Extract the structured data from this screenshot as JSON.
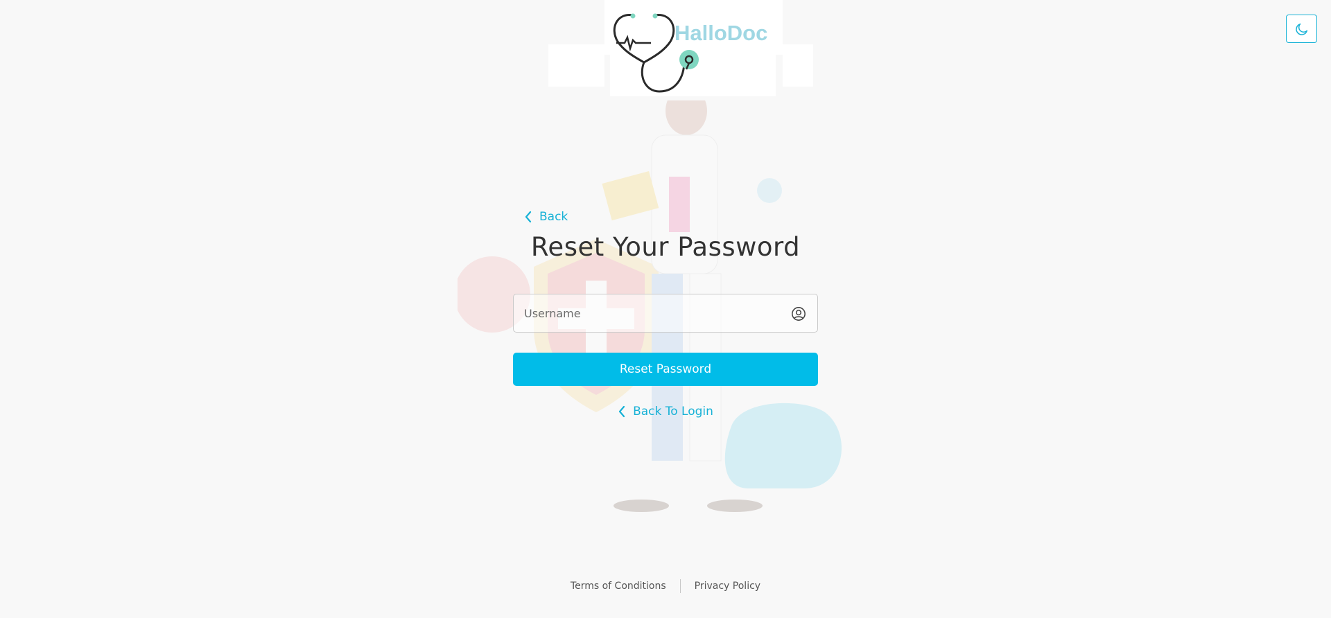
{
  "brand": {
    "name": "HalloDoc",
    "colors": {
      "accent": "#01bce8",
      "link": "#16b1d6",
      "logo_text": "#9fd7e3",
      "logo_dot": "#7fd6c0"
    }
  },
  "theme_toggle": {
    "icon": "moon-icon"
  },
  "back_link": {
    "label": "Back",
    "icon": "chevron-left-icon"
  },
  "page": {
    "title": "Reset Your Password"
  },
  "form": {
    "username": {
      "placeholder": "Username",
      "value": "",
      "icon": "user-circle-icon"
    },
    "submit_label": "Reset Password"
  },
  "login_link": {
    "label": "Back To Login",
    "icon": "chevron-left-icon"
  },
  "footer": {
    "terms": "Terms of Conditions",
    "privacy": "Privacy Policy"
  }
}
